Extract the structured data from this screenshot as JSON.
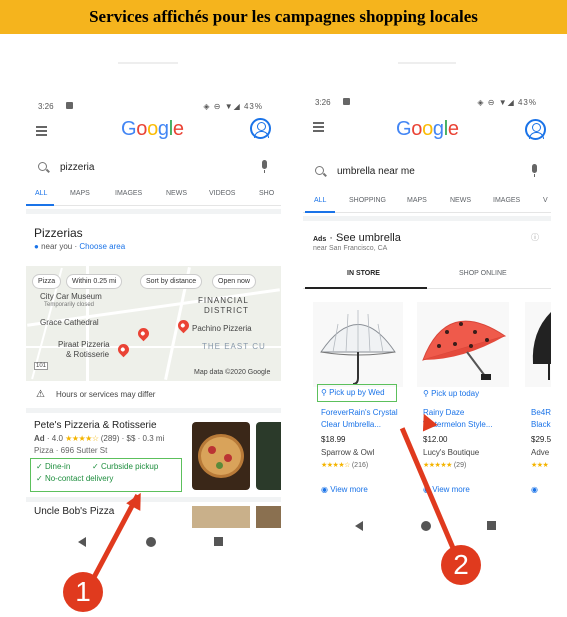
{
  "banner": {
    "title": "Services affichés pour les campagnes shopping locales"
  },
  "colors": {
    "banner": "#f5b41d",
    "accent": "#1a73e8",
    "highlight": "#5cc05c",
    "arrow": "#e03a1e"
  },
  "icons": [
    "menu-icon",
    "account-icon",
    "search-icon",
    "mic-icon",
    "map-pin-icon",
    "warning-icon",
    "check-icon",
    "location-pin-icon",
    "eye-icon",
    "back-icon",
    "home-icon",
    "recents-icon"
  ],
  "phone1": {
    "status": {
      "time": "3:26",
      "icons": "◈ ⊖ ▼◢ 43%"
    },
    "logo": "Google",
    "search": "pizzeria",
    "tabs": [
      "ALL",
      "MAPS",
      "IMAGES",
      "NEWS",
      "VIDEOS",
      "SHO"
    ],
    "local": {
      "title": "Pizzerias",
      "near": "near you",
      "choose": "Choose area"
    },
    "map": {
      "chips": [
        "Pizza",
        "Within 0.25 mi",
        "Sort by distance",
        "Open now"
      ],
      "labels": [
        "City Car Museum",
        "Temporarily closed",
        "FINANCIAL",
        "DISTRICT",
        "Grace Cathedral",
        "Pachino Pizzeria",
        "Piraat Pizzeria",
        "& Rotisserie",
        "THE EAST CU",
        "Map data ©2020 Google",
        "101"
      ]
    },
    "notice": "Hours or services may differ",
    "result": {
      "name": "Pete's Pizzeria & Rotisserie",
      "ad": "Ad",
      "rating": "4.0",
      "stars": "★★★★☆",
      "reviews": "(289)",
      "price": "$$ · 0.3 mi",
      "address": "Pizza · 696 Sutter St",
      "services": [
        "Dine-in",
        "Curbside pickup",
        "No-contact delivery"
      ]
    },
    "next": {
      "name": "Uncle Bob's Pizza"
    }
  },
  "phone2": {
    "status": {
      "time": "3:26",
      "icons": "◈ ⊖ ▼◢ 43%"
    },
    "logo": "Google",
    "search": "umbrella near me",
    "tabs": [
      "ALL",
      "SHOPPING",
      "MAPS",
      "NEWS",
      "IMAGES",
      "V"
    ],
    "ads": {
      "label": "Ads",
      "title": "See umbrella",
      "near": "near San Francisco, CA"
    },
    "store_tabs": [
      "IN STORE",
      "SHOP ONLINE"
    ],
    "products": [
      {
        "pickup": "Pick up by Wed",
        "name1": "ForeverRain's Crystal",
        "name2": "Clear Umbrella...",
        "price": "$18.99",
        "store": "Sparrow & Owl",
        "rating": "★★★★☆",
        "reviews": "(216)",
        "more": "View more"
      },
      {
        "pickup": "Pick up today",
        "name1": "Rainy Daze",
        "name2": "Watermelon Style...",
        "price": "$12.00",
        "store": "Lucy's Boutique",
        "rating": "★★★★★",
        "reviews": "(29)",
        "more": "View more"
      },
      {
        "pickup": "",
        "name1": "Be4R",
        "name2": "Black",
        "price": "$29.5",
        "store": "Adve",
        "rating": "★★★",
        "reviews": "",
        "more": ""
      }
    ]
  },
  "markers": {
    "one": "1",
    "two": "2"
  }
}
